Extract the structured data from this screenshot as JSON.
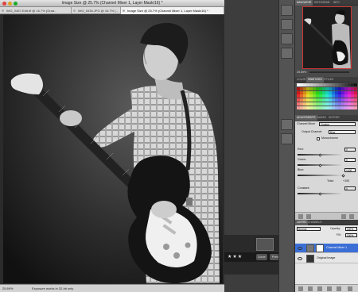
{
  "document": {
    "title": "Image Size @ 25.7% (Channel Mixer 1, Layer Mask/16) *",
    "tabs": [
      "IMG_0467-Edit.tif @ 16.7% (Grad...",
      "IMG_5336.JPG @ 16.7% (...",
      "Image Size @ 25.7% (Channel Mixer 1, Layer Mask/16) *"
    ],
    "status_zoom": "25.69%",
    "status_info": "Exposure works in 32-bit only"
  },
  "filmstrip": {
    "stars": "★★★",
    "buttons": [
      "Done",
      "Prev"
    ]
  },
  "navigator": {
    "tabs": [
      "NAVIGATOR",
      "HISTOGRAM",
      "INFO"
    ],
    "zoom": "25.69%"
  },
  "swatches": {
    "tabs": [
      "COLOR",
      "SWATCHES",
      "STYLES"
    ]
  },
  "adjustments": {
    "tabs": [
      "ADJUSTMENTS",
      "MASKS",
      "HISTORY"
    ],
    "preset_label": "Channel Mixer",
    "preset_value": "Custom",
    "output_label": "Output Channel:",
    "output_value": "Blue",
    "monochrome_label": "Monochrome",
    "red_label": "Red:",
    "red_value": "0",
    "red_fraction": 0.5,
    "green_label": "Green:",
    "green_value": "0",
    "green_fraction": 0.5,
    "blue_label": "Blue:",
    "blue_value": "+100",
    "blue_fraction": 1.0,
    "total_label": "Total:",
    "total_value": "+100",
    "constant_label": "Constant:",
    "constant_value": "0",
    "constant_fraction": 0.5
  },
  "layers": {
    "tabs": [
      "LAYERS",
      "CHANNELS"
    ],
    "blend_mode": "Normal",
    "opacity_label": "Opacity:",
    "opacity_value": "100%",
    "fill_label": "Fill:",
    "fill_value": "100%",
    "items": [
      {
        "name": "Channel Mixer 1"
      },
      {
        "name": "Original Image"
      }
    ]
  },
  "icons": [
    "close-icon",
    "minimize-icon",
    "zoom-icon",
    "eye-icon",
    "link-icon",
    "mask-icon",
    "trash-icon"
  ],
  "colors": {
    "accent": "#3b6fd6",
    "nav_frame": "#cc3333"
  }
}
